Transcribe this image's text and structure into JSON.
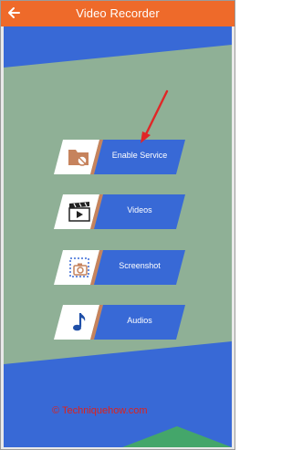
{
  "app_bar": {
    "title": "Video Recorder",
    "back_icon": "arrow-left-icon",
    "color": "#ee6a2a"
  },
  "colors": {
    "blue": "#3869d6",
    "sage": "#8fb096",
    "green": "#44a66a",
    "icon_box": "#ffffff",
    "accent": "#c6835d",
    "arrow": "#e02727"
  },
  "menu": [
    {
      "label": "Enable Service",
      "icon": "folder-block-icon"
    },
    {
      "label": "Videos",
      "icon": "clapperboard-icon"
    },
    {
      "label": "Screenshot",
      "icon": "screenshot-camera-icon"
    },
    {
      "label": "Audios",
      "icon": "music-note-icon"
    }
  ],
  "watermark": "© Techniquehow.com"
}
